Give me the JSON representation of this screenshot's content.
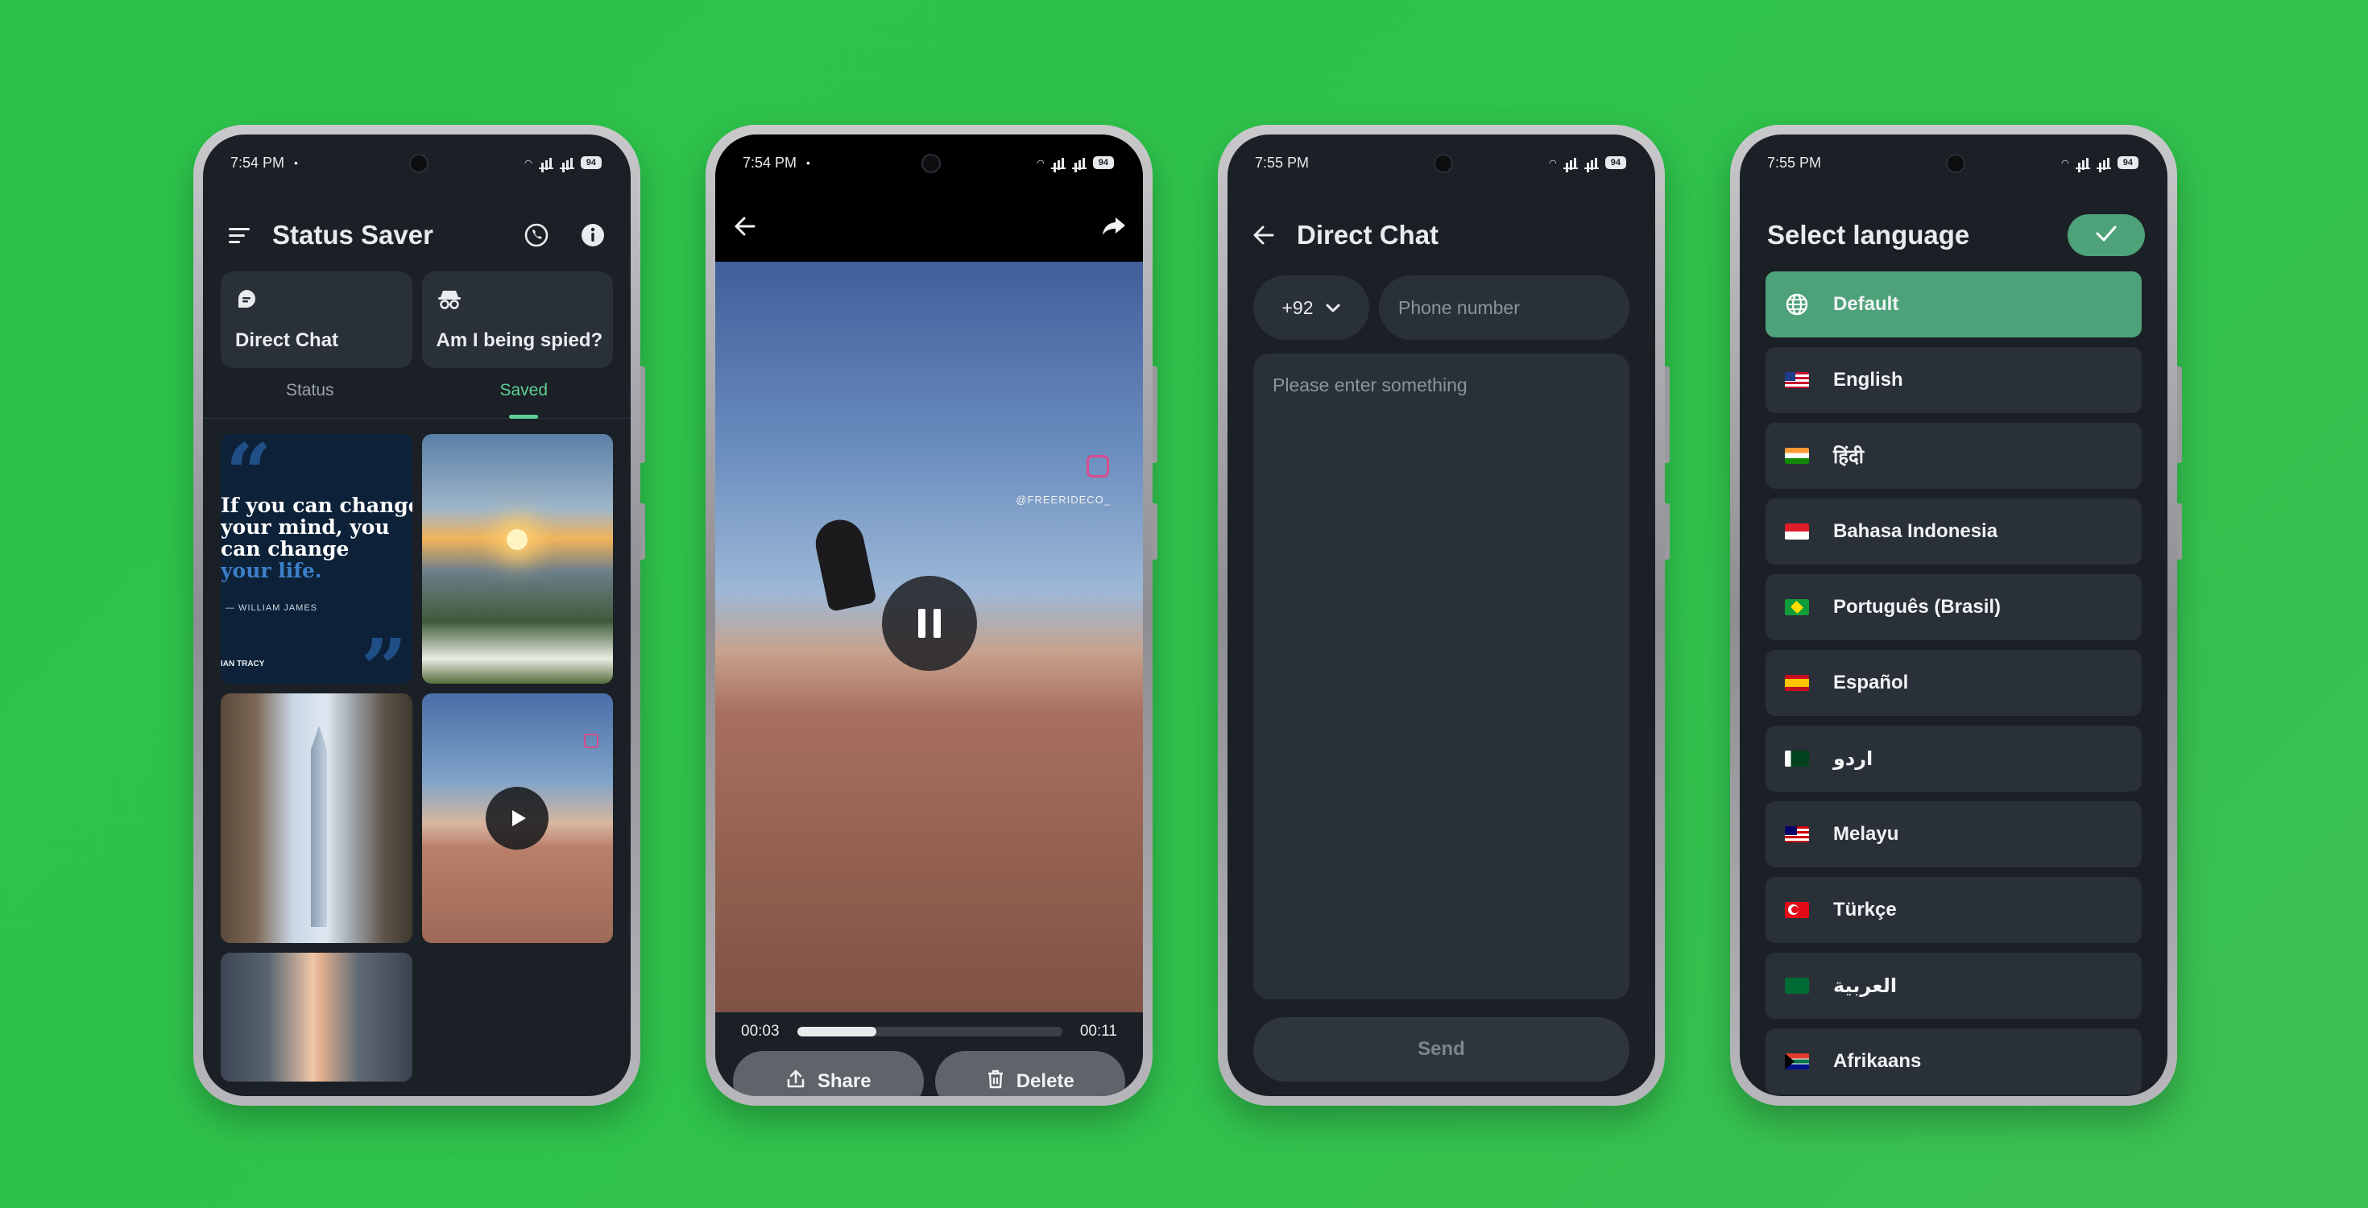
{
  "screens": {
    "home": {
      "status_time": "7:54 PM",
      "battery": "94",
      "title": "Status Saver",
      "cards": [
        {
          "label": "Direct Chat",
          "icon": "chat-bubble-icon"
        },
        {
          "label": "Am I being spied?",
          "icon": "spy-icon"
        }
      ],
      "tabs": [
        {
          "label": "Status",
          "active": false
        },
        {
          "label": "Saved",
          "active": true
        }
      ],
      "quote": {
        "line1": "If you can change",
        "line2": "your mind, you",
        "line3": "can change",
        "line4": "your life.",
        "author": "— WILLIAM JAMES",
        "footer": "IAN TRACY"
      }
    },
    "player": {
      "status_time": "7:54 PM",
      "battery": "94",
      "watermark": "@FREERIDECO_",
      "current_time": "00:03",
      "duration": "00:11",
      "progress": 0.3,
      "share_label": "Share",
      "delete_label": "Delete"
    },
    "direct_chat": {
      "status_time": "7:55 PM",
      "battery": "94",
      "title": "Direct Chat",
      "country_code": "+92",
      "phone_placeholder": "Phone number",
      "message_placeholder": "Please enter something",
      "send_label": "Send"
    },
    "language": {
      "status_time": "7:55 PM",
      "battery": "94",
      "title": "Select language",
      "languages": [
        {
          "label": "Default",
          "flag": "globe-icon",
          "selected": true
        },
        {
          "label": "English",
          "flag": "us"
        },
        {
          "label": "हिंदी",
          "flag": "in"
        },
        {
          "label": "Bahasa Indonesia",
          "flag": "id"
        },
        {
          "label": "Português (Brasil)",
          "flag": "br"
        },
        {
          "label": "Español",
          "flag": "es"
        },
        {
          "label": "اردو",
          "flag": "pk"
        },
        {
          "label": "Melayu",
          "flag": "my"
        },
        {
          "label": "Türkçe",
          "flag": "tr"
        },
        {
          "label": "العربية",
          "flag": "sa"
        },
        {
          "label": "Afrikaans",
          "flag": "za"
        }
      ]
    }
  },
  "colors": {
    "background_green": "#2cc34a",
    "accent_green": "#4ea27a",
    "tab_active": "#5ecf94",
    "surface": "#2a3038",
    "screen_bg": "#1b2026"
  }
}
